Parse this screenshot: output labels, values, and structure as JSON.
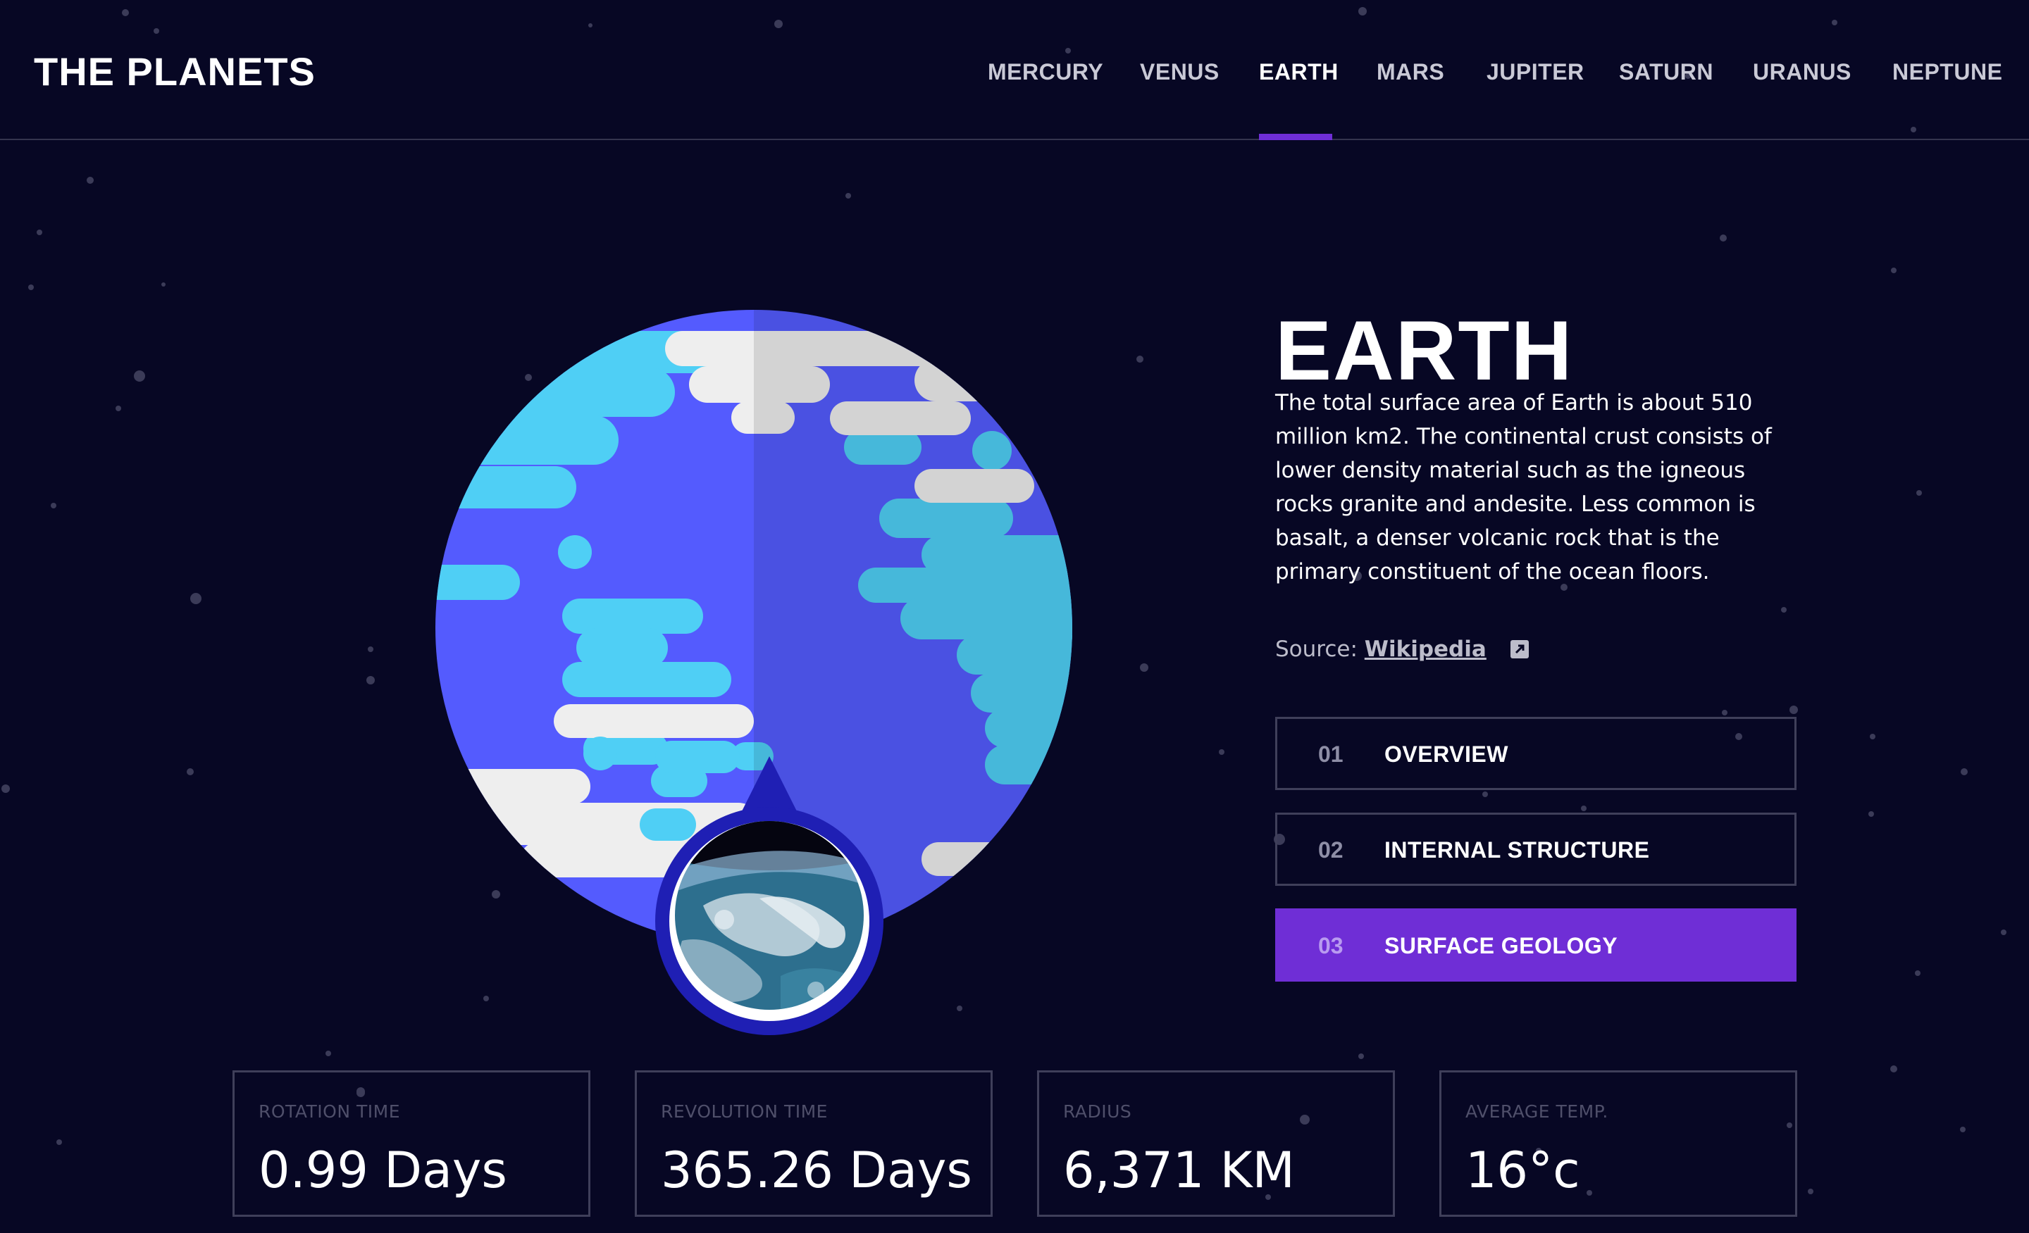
{
  "site": {
    "logo": "THE PLANETS"
  },
  "nav": {
    "items": [
      {
        "label": "MERCURY"
      },
      {
        "label": "VENUS"
      },
      {
        "label": "EARTH",
        "active": true
      },
      {
        "label": "MARS"
      },
      {
        "label": "JUPITER"
      },
      {
        "label": "SATURN"
      },
      {
        "label": "URANUS"
      },
      {
        "label": "NEPTUNE"
      }
    ]
  },
  "planet": {
    "name": "EARTH",
    "description": "The total surface area of Earth is about 510 million km2. The continental crust consists of lower density material such as the igneous rocks granite and andesite. Less common is basalt, a denser volcanic rock that is the primary constituent of the ocean floors.",
    "source_label": "Source:",
    "source_link": "Wikipedia",
    "source_icon": "external-link-icon",
    "planet_icon": "earth-planet-illustration",
    "geology_image": "earth-surface-photo"
  },
  "tabs": [
    {
      "number": "01",
      "label": "OVERVIEW"
    },
    {
      "number": "02",
      "label": "INTERNAL STRUCTURE"
    },
    {
      "number": "03",
      "label": "SURFACE GEOLOGY",
      "active": true
    }
  ],
  "stats": [
    {
      "label": "ROTATION TIME",
      "value": "0.99 Days"
    },
    {
      "label": "REVOLUTION TIME",
      "value": "365.26 Days"
    },
    {
      "label": "RADIUS",
      "value": "6,371 KM"
    },
    {
      "label": "AVERAGE TEMP.",
      "value": "16°c"
    }
  ],
  "colors": {
    "background": "#070724",
    "accent": "#6F2ED6",
    "ocean": "#545BFE",
    "continent": "#4FCFF5",
    "cloud": "#EEEEEE",
    "pin": "#1F1FB4"
  }
}
